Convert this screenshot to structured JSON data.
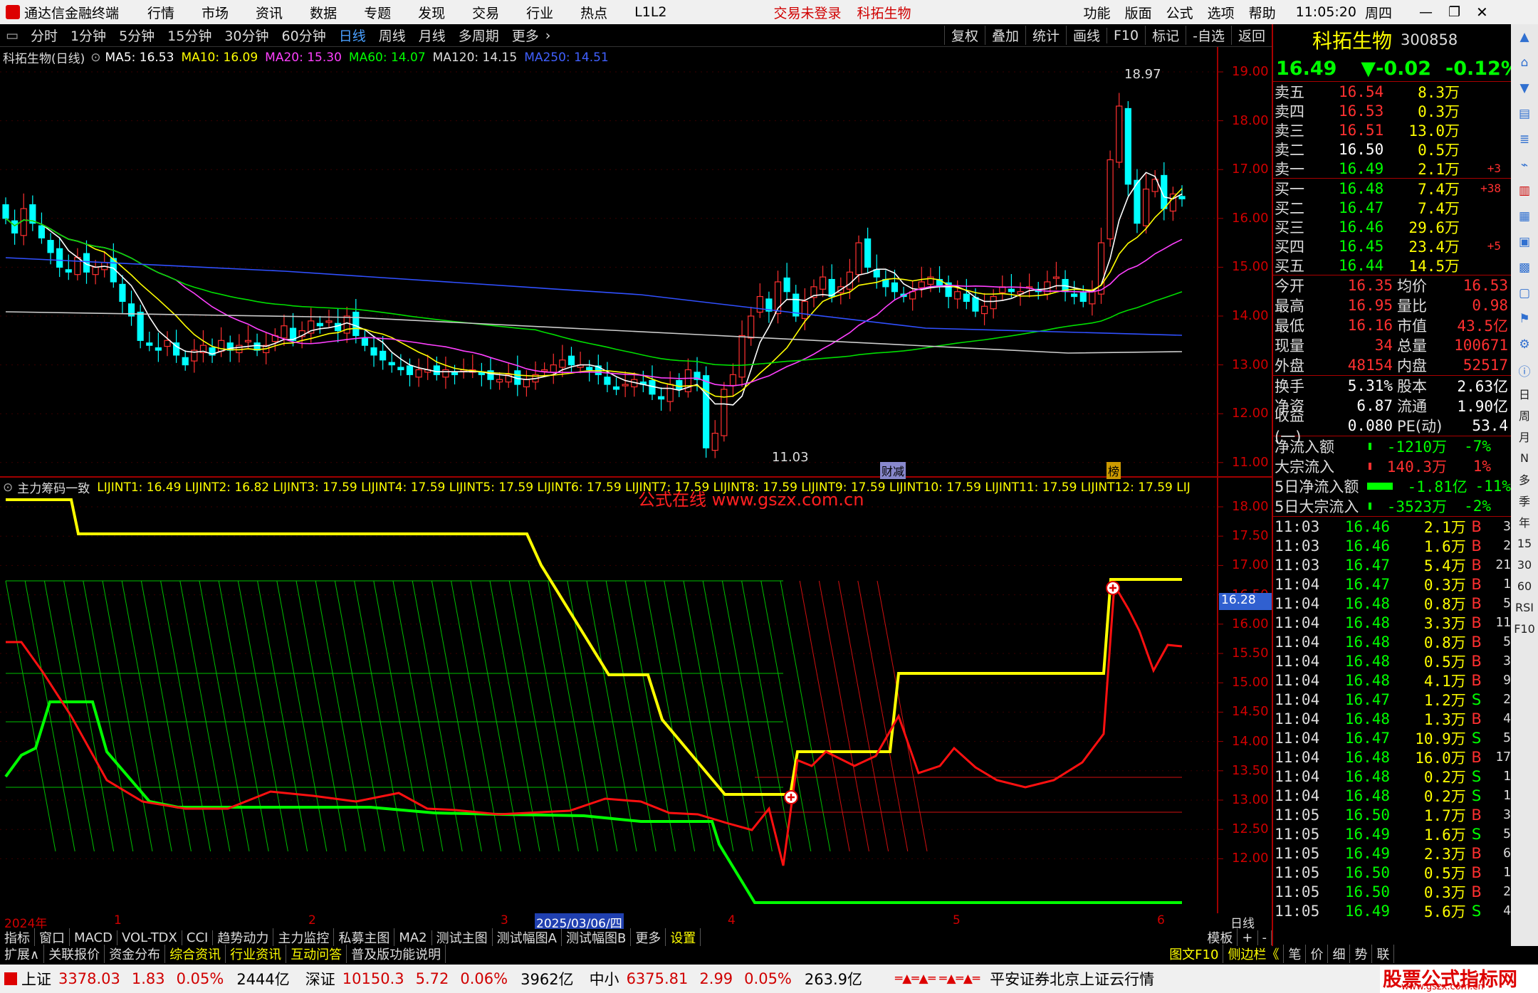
{
  "titlebar": {
    "app_name": "通达信金融终端",
    "menu": [
      "行情",
      "市场",
      "资讯",
      "数据",
      "专题",
      "发现",
      "交易",
      "行业",
      "热点",
      "L1L2"
    ],
    "login_status": "交易未登录",
    "stock_title": "科拓生物",
    "right_menu": [
      "功能",
      "版面",
      "公式",
      "选项",
      "帮助"
    ],
    "time": "11:05:20",
    "weekday": "周四"
  },
  "periodbar": {
    "periods": [
      "分时",
      "1分钟",
      "5分钟",
      "15分钟",
      "30分钟",
      "60分钟",
      "日线",
      "周线",
      "月线",
      "多周期",
      "更多"
    ],
    "active": "日线",
    "right_buttons": [
      "复权",
      "叠加",
      "统计",
      "画线",
      "F10",
      "标记",
      "-自选",
      "返回"
    ]
  },
  "main_chart": {
    "title": "科拓生物(日线)",
    "ma_labels": [
      {
        "text": "MA5: 16.53",
        "color": "#ffffff"
      },
      {
        "text": "MA10: 16.09",
        "color": "#ffff00"
      },
      {
        "text": "MA20: 15.30",
        "color": "#ff40ff"
      },
      {
        "text": "MA60: 14.07",
        "color": "#00ff00"
      },
      {
        "text": "MA120: 14.15",
        "color": "#dddddd"
      },
      {
        "text": "MA250: 14.51",
        "color": "#4060ff"
      }
    ],
    "price_ticks": [
      "19.00",
      "18.00",
      "17.00",
      "16.00",
      "15.00",
      "14.00",
      "13.00",
      "12.00",
      "11.00"
    ],
    "high_label": "18.97",
    "low_label": "11.03",
    "marker_cai": "财减",
    "marker_bang": "榜"
  },
  "indicator": {
    "title": "主力筹码一致",
    "lines": "LIJINT1: 16.49  LIJINT2: 16.82  LIJINT3: 17.59  LIJINT4: 17.59  LIJINT5: 17.59  LIJINT6: 17.59  LIJINT7: 17.59  LIJINT8: 17.59  LIJINT9: 17.59  LIJINT10: 17.59  LIJINT11: 17.59  LIJINT12: 17.59  LIJ",
    "watermark": "公式在线  www.gszx.com.cn",
    "ticks": [
      "18.00",
      "17.50",
      "17.00",
      "16.50",
      "16.00",
      "15.50",
      "15.00",
      "14.50",
      "14.00",
      "13.50",
      "13.00",
      "12.50",
      "12.00"
    ],
    "current_value": "16.28"
  },
  "time_axis": {
    "labels": [
      "2024年",
      "1",
      "2",
      "3",
      "4",
      "5",
      "6"
    ],
    "highlight_date": "2025/03/06/四",
    "right_label": "日线"
  },
  "quote": {
    "name": "科拓生物",
    "code": "300858",
    "price": "16.49",
    "change": "▼-0.02",
    "change_pct": "-0.12%",
    "asks": [
      {
        "label": "卖五",
        "price": "16.54",
        "vol": "8.3万",
        "extra": ""
      },
      {
        "label": "卖四",
        "price": "16.53",
        "vol": "0.3万",
        "extra": ""
      },
      {
        "label": "卖三",
        "price": "16.51",
        "vol": "13.0万",
        "extra": ""
      },
      {
        "label": "卖二",
        "price": "16.50",
        "vol": "0.5万",
        "extra": ""
      },
      {
        "label": "卖一",
        "price": "16.49",
        "vol": "2.1万",
        "extra": "+3"
      }
    ],
    "bids": [
      {
        "label": "买一",
        "price": "16.48",
        "vol": "7.4万",
        "extra": "+38"
      },
      {
        "label": "买二",
        "price": "16.47",
        "vol": "7.4万",
        "extra": ""
      },
      {
        "label": "买三",
        "price": "16.46",
        "vol": "29.6万",
        "extra": ""
      },
      {
        "label": "买四",
        "price": "16.45",
        "vol": "23.4万",
        "extra": "+5"
      },
      {
        "label": "买五",
        "price": "16.44",
        "vol": "14.5万",
        "extra": ""
      }
    ],
    "stats": [
      [
        "今开",
        "16.35",
        "均价",
        "16.53"
      ],
      [
        "最高",
        "16.95",
        "量比",
        "0.98"
      ],
      [
        "最低",
        "16.16",
        "市值",
        "43.5亿"
      ],
      [
        "现量",
        "34",
        "总量",
        "100671"
      ],
      [
        "外盘",
        "48154",
        "内盘",
        "52517"
      ]
    ],
    "stats2": [
      [
        "换手",
        "5.31%",
        "股本",
        "2.63亿"
      ],
      [
        "净资",
        "6.87",
        "流通",
        "1.90亿"
      ],
      [
        "收益(一)",
        "0.080",
        "PE(动)",
        "53.4"
      ]
    ],
    "flows": [
      {
        "label": "净流入额",
        "value": "-1210万",
        "pct": "-7%"
      },
      {
        "label": "大宗流入",
        "value": "140.3万",
        "pct": "1%"
      },
      {
        "label": "5日净流入额",
        "value": "-1.81亿",
        "pct": "-11%"
      },
      {
        "label": "5日大宗流入",
        "value": "-3523万",
        "pct": "-2%"
      }
    ],
    "ticks": [
      [
        "11:03",
        "16.46",
        "2.1万",
        "B",
        "3"
      ],
      [
        "11:03",
        "16.46",
        "1.6万",
        "B",
        "2"
      ],
      [
        "11:03",
        "16.47",
        "5.4万",
        "B",
        "21"
      ],
      [
        "11:04",
        "16.47",
        "0.3万",
        "B",
        "1"
      ],
      [
        "11:04",
        "16.48",
        "0.8万",
        "B",
        "5"
      ],
      [
        "11:04",
        "16.48",
        "3.3万",
        "B",
        "11"
      ],
      [
        "11:04",
        "16.48",
        "0.8万",
        "B",
        "5"
      ],
      [
        "11:04",
        "16.48",
        "0.5万",
        "B",
        "3"
      ],
      [
        "11:04",
        "16.48",
        "4.1万",
        "B",
        "9"
      ],
      [
        "11:04",
        "16.47",
        "1.2万",
        "S",
        "2"
      ],
      [
        "11:04",
        "16.48",
        "1.3万",
        "B",
        "4"
      ],
      [
        "11:04",
        "16.47",
        "10.9万",
        "S",
        "5"
      ],
      [
        "11:04",
        "16.48",
        "16.0万",
        "B",
        "17"
      ],
      [
        "11:04",
        "16.48",
        "0.2万",
        "S",
        "1"
      ],
      [
        "11:04",
        "16.48",
        "0.2万",
        "S",
        "1"
      ],
      [
        "11:05",
        "16.50",
        "1.7万",
        "B",
        "3"
      ],
      [
        "11:05",
        "16.49",
        "1.6万",
        "S",
        "5"
      ],
      [
        "11:05",
        "16.49",
        "2.3万",
        "B",
        "6"
      ],
      [
        "11:05",
        "16.50",
        "0.5万",
        "B",
        "1"
      ],
      [
        "11:05",
        "16.50",
        "0.3万",
        "B",
        "2"
      ],
      [
        "11:05",
        "16.49",
        "5.6万",
        "S",
        "4"
      ]
    ]
  },
  "sidebar": [
    "日",
    "周",
    "月",
    "N",
    "多",
    "季",
    "年",
    "15",
    "30",
    "60",
    "RSI",
    "F10"
  ],
  "tabbar": {
    "tabs": [
      "指标",
      "窗口",
      "MACD",
      "VOL-TDX",
      "CCI",
      "趋势动力",
      "主力监控",
      "私募主图",
      "MA2",
      "测试主图",
      "测试幅图A",
      "测试幅图B",
      "更多",
      "设置"
    ],
    "highlight": "设置",
    "right": [
      "模板",
      "+",
      "-"
    ]
  },
  "tabbar2": {
    "tabs": [
      "扩展∧",
      "关联报价",
      "资金分布",
      "综合资讯",
      "行业资讯",
      "互动问答",
      "普及版功能说明"
    ],
    "right": [
      "图文F10",
      "侧边栏《",
      "笔",
      "价",
      "细",
      "势",
      "联"
    ]
  },
  "statusbar": {
    "items": [
      {
        "name": "上证",
        "value": "3378.03",
        "chg": "1.83",
        "pct": "0.05%",
        "amt": "2444亿"
      },
      {
        "name": "深证",
        "value": "10150.3",
        "chg": "5.72",
        "pct": "0.06%",
        "amt": "3962亿"
      },
      {
        "name": "中小",
        "value": "6375.81",
        "chg": "2.99",
        "pct": "0.05%",
        "amt": "263.9亿"
      }
    ],
    "server": "平安证券北京上证云行情",
    "brand": "股票公式指标网",
    "brand_url": "www.gszx.com.cn"
  },
  "colors": {
    "up": "#ff3030",
    "down": "#00ffff",
    "ask_label": "#ffffff",
    "yellow": "#ffff00",
    "green": "#00ff00",
    "red": "#ff2020"
  }
}
